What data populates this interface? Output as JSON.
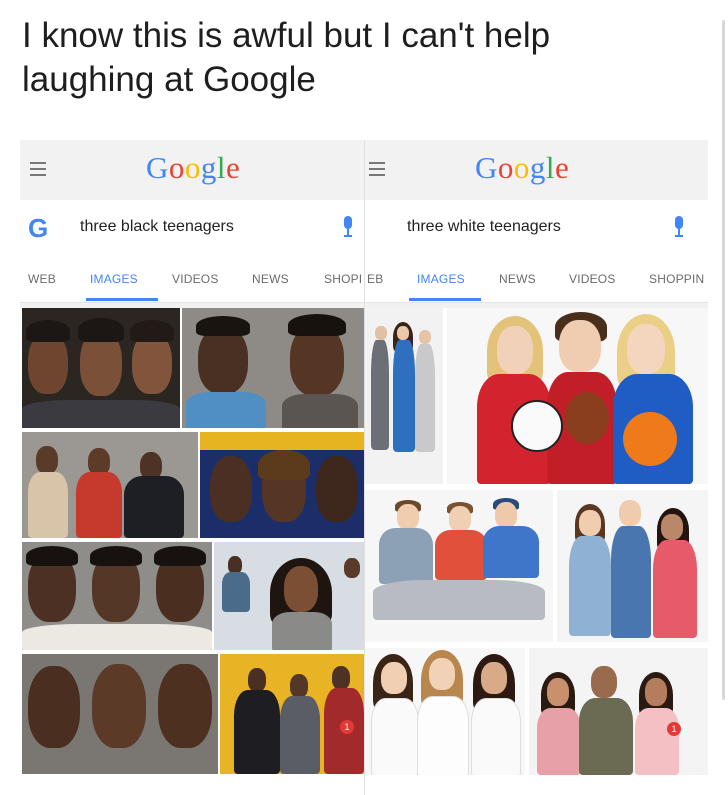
{
  "caption": "I know this is awful but I can't help laughing at Google",
  "left_screen": {
    "logo": "Google",
    "search_query": "three black teenagers",
    "tabs": [
      "WEB",
      "IMAGES",
      "VIDEOS",
      "NEWS",
      "SHOPI"
    ],
    "active_tab": "IMAGES"
  },
  "right_screen": {
    "logo": "Google",
    "search_query": "three white teenagers",
    "tabs": [
      "EB",
      "IMAGES",
      "NEWS",
      "VIDEOS",
      "SHOPPIN"
    ],
    "active_tab": "IMAGES"
  },
  "thumbnail_badges": [
    "1",
    "1"
  ],
  "colors": {
    "google_blue": "#4285f4",
    "google_red": "#ea4335",
    "google_yellow": "#fbbc05",
    "google_green": "#34a853"
  },
  "icons": [
    "menu-icon",
    "google-g-icon",
    "microphone-icon",
    "microphone-icon"
  ]
}
